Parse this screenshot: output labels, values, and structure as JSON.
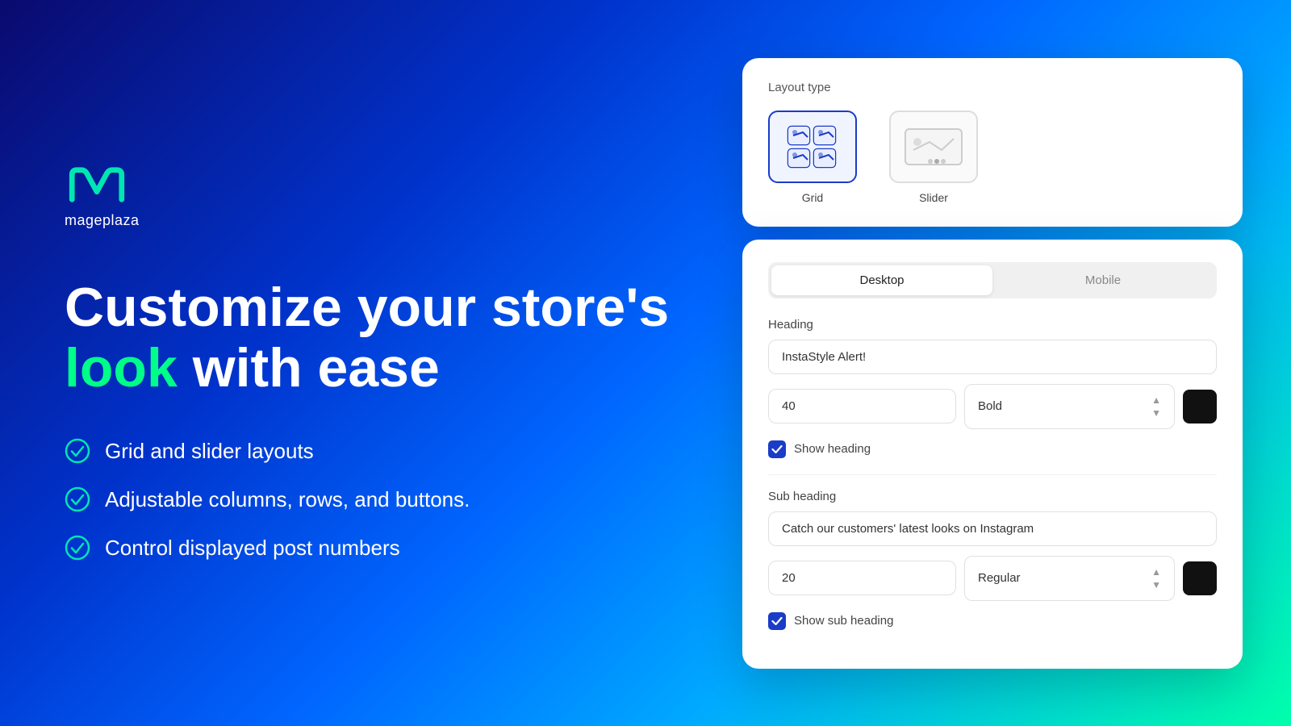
{
  "logo": {
    "text": "mageplaza"
  },
  "hero": {
    "line1": "Customize your store's",
    "highlight": "look",
    "line2": " with ease"
  },
  "features": [
    {
      "id": 1,
      "text": "Grid and slider layouts"
    },
    {
      "id": 2,
      "text": "Adjustable columns, rows, and buttons."
    },
    {
      "id": 3,
      "text": "Control displayed post numbers"
    }
  ],
  "layout_card": {
    "title": "Layout type",
    "options": [
      {
        "id": "grid",
        "label": "Grid",
        "selected": true
      },
      {
        "id": "slider",
        "label": "Slider",
        "selected": false
      }
    ]
  },
  "settings_card": {
    "tabs": [
      {
        "id": "desktop",
        "label": "Desktop",
        "active": true
      },
      {
        "id": "mobile",
        "label": "Mobile",
        "active": false
      }
    ],
    "heading": {
      "section_label": "Heading",
      "value": "InstaStyle Alert!",
      "size": "40",
      "font_weight": "Bold",
      "show_label": "Show heading",
      "show_checked": true
    },
    "sub_heading": {
      "section_label": "Sub heading",
      "value": "Catch our customers' latest looks on Instagram",
      "size": "20",
      "font_weight": "Regular",
      "show_label": "Show sub heading",
      "show_checked": true
    }
  }
}
